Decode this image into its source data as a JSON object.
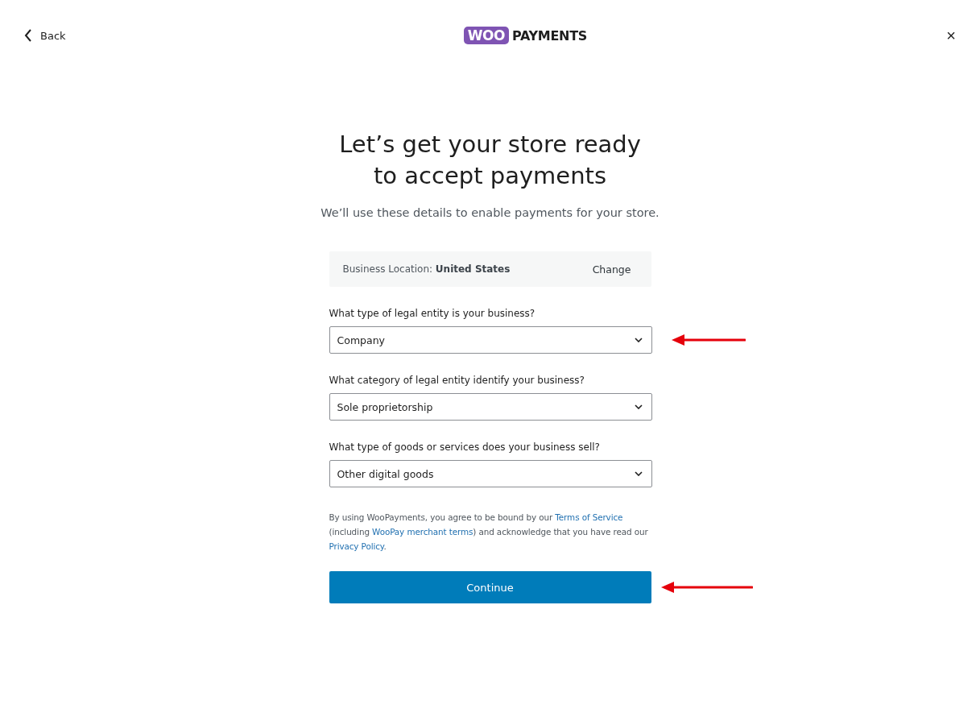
{
  "header": {
    "back": "Back",
    "logo_mark": "WOO",
    "logo_text": "PAYMENTS",
    "close": "×"
  },
  "title_lines": [
    "Let’s get your store ready",
    "to accept payments"
  ],
  "subtitle": "We’ll use these details to enable payments for your store.",
  "location": {
    "label": "Business Location:",
    "value": "United States",
    "action": "Change"
  },
  "fields": [
    {
      "label": "What type of legal entity is your business?",
      "value": "Company",
      "annotated": true
    },
    {
      "label": "What category of legal entity identify your business?",
      "value": "Sole proprietorship",
      "annotated": false
    },
    {
      "label": "What type of goods or services does your business sell?",
      "value": "Other digital goods",
      "annotated": false
    }
  ],
  "terms": [
    {
      "text": "By using WooPayments, you agree to be bound by our ",
      "link": false
    },
    {
      "text": "Terms of Service",
      "link": true
    },
    {
      "text": " (including ",
      "link": false
    },
    {
      "text": "WooPay merchant terms",
      "link": true
    },
    {
      "text": ") and acknowledge that you have read our ",
      "link": false
    },
    {
      "text": "Privacy Policy",
      "link": true
    },
    {
      "text": ".",
      "link": false
    }
  ],
  "submit": {
    "label": "Continue",
    "annotated": true
  }
}
